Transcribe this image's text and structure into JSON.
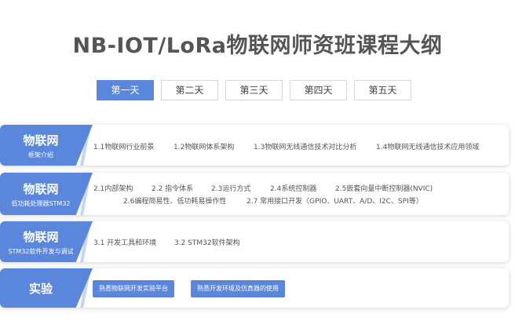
{
  "title": "NB-IOT/LoRa物联网师资班课程大纲",
  "tabs": [
    {
      "label": "第一天",
      "active": true
    },
    {
      "label": "第二天",
      "active": false
    },
    {
      "label": "第三天",
      "active": false
    },
    {
      "label": "第四天",
      "active": false
    },
    {
      "label": "第五天",
      "active": false
    }
  ],
  "rows": [
    {
      "title": "物联网",
      "subtitle": "框架介绍",
      "items": [
        "1.1物联网行业前景",
        "1.2物联网体系架构",
        "1.3物联网无线通信技术对比分析",
        "1.4物联网无线通信技术应用领域"
      ]
    },
    {
      "title": "物联网",
      "subtitle": "低功耗处理器STM32",
      "items": [
        "2.1内部架构",
        "2.2 指令体系",
        "2.3运行方式",
        "2.4系统控制器",
        "2.5嵌套向量中断控制器(NVIC)",
        "2.6编程简易性、低功耗易操作性",
        "2.7 常用接口开发（GPIO、UART、A/D、I2C、SPI等）"
      ]
    },
    {
      "title": "物联网",
      "subtitle": "STM32软件开发与调试",
      "items": [
        "3.1 开发工具和环境",
        "3.2 STM32软件架构"
      ]
    },
    {
      "title": "实验",
      "subtitle": "",
      "buttons": [
        "熟悉物联网开发实验平台",
        "熟悉开发环境及仿真器的使用"
      ]
    }
  ],
  "colors": {
    "accent": "#5a86dc",
    "title": "#555555"
  }
}
